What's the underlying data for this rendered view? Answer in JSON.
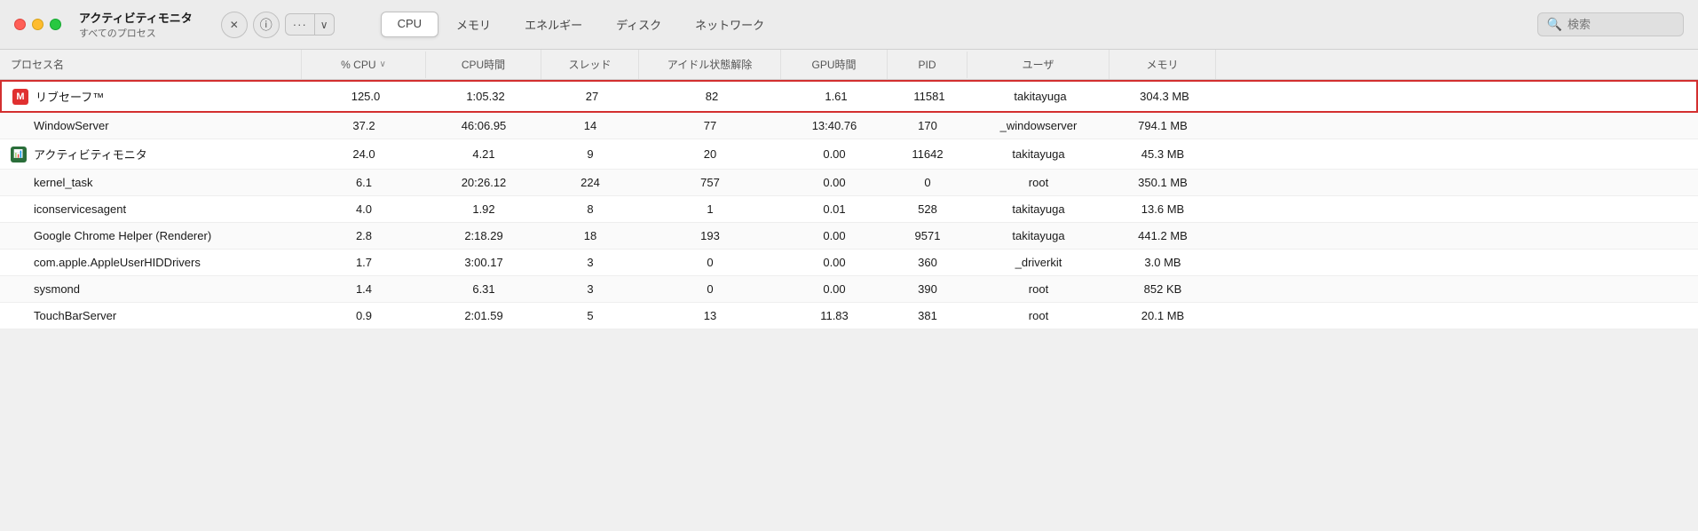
{
  "window": {
    "title": "アクティビティモニタ",
    "subtitle": "すべてのプロセス"
  },
  "traffic_lights": {
    "red_label": "close",
    "yellow_label": "minimize",
    "green_label": "maximize"
  },
  "toolbar": {
    "close_icon": "✕",
    "info_icon": "ⓘ",
    "more_icon": "···",
    "chevron_icon": "∨"
  },
  "tabs": [
    {
      "label": "CPU",
      "active": true
    },
    {
      "label": "メモリ",
      "active": false
    },
    {
      "label": "エネルギー",
      "active": false
    },
    {
      "label": "ディスク",
      "active": false
    },
    {
      "label": "ネットワーク",
      "active": false
    }
  ],
  "search": {
    "placeholder": "検索",
    "value": ""
  },
  "columns": [
    {
      "key": "name",
      "label": "プロセス名"
    },
    {
      "key": "cpu",
      "label": "% CPU",
      "sorted": true,
      "sort_dir": "desc"
    },
    {
      "key": "cputime",
      "label": "CPU時間"
    },
    {
      "key": "threads",
      "label": "スレッド"
    },
    {
      "key": "idle",
      "label": "アイドル状態解除"
    },
    {
      "key": "gpu",
      "label": "GPU時間"
    },
    {
      "key": "pid",
      "label": "PID"
    },
    {
      "key": "user",
      "label": "ユーザ"
    },
    {
      "key": "mem",
      "label": "メモリ"
    }
  ],
  "rows": [
    {
      "name": "リブセーフ™",
      "cpu": "125.0",
      "cputime": "1:05.32",
      "threads": "27",
      "idle": "82",
      "gpu": "1.61",
      "pid": "11581",
      "user": "takitayuga",
      "mem": "304.3 MB",
      "highlighted": true,
      "has_icon": true,
      "icon_type": "libsafe"
    },
    {
      "name": "WindowServer",
      "cpu": "37.2",
      "cputime": "46:06.95",
      "threads": "14",
      "idle": "77",
      "gpu": "13:40.76",
      "pid": "170",
      "user": "_windowserver",
      "mem": "794.1 MB",
      "highlighted": false,
      "has_icon": false
    },
    {
      "name": "アクティビティモニタ",
      "cpu": "24.0",
      "cputime": "4.21",
      "threads": "9",
      "idle": "20",
      "gpu": "0.00",
      "pid": "11642",
      "user": "takitayuga",
      "mem": "45.3 MB",
      "highlighted": false,
      "has_icon": true,
      "icon_type": "activity"
    },
    {
      "name": "kernel_task",
      "cpu": "6.1",
      "cputime": "20:26.12",
      "threads": "224",
      "idle": "757",
      "gpu": "0.00",
      "pid": "0",
      "user": "root",
      "mem": "350.1 MB",
      "highlighted": false,
      "has_icon": false
    },
    {
      "name": "iconservicesagent",
      "cpu": "4.0",
      "cputime": "1.92",
      "threads": "8",
      "idle": "1",
      "gpu": "0.01",
      "pid": "528",
      "user": "takitayuga",
      "mem": "13.6 MB",
      "highlighted": false,
      "has_icon": false
    },
    {
      "name": "Google Chrome Helper (Renderer)",
      "cpu": "2.8",
      "cputime": "2:18.29",
      "threads": "18",
      "idle": "193",
      "gpu": "0.00",
      "pid": "9571",
      "user": "takitayuga",
      "mem": "441.2 MB",
      "highlighted": false,
      "has_icon": false
    },
    {
      "name": "com.apple.AppleUserHIDDrivers",
      "cpu": "1.7",
      "cputime": "3:00.17",
      "threads": "3",
      "idle": "0",
      "gpu": "0.00",
      "pid": "360",
      "user": "_driverkit",
      "mem": "3.0 MB",
      "highlighted": false,
      "has_icon": false
    },
    {
      "name": "sysmond",
      "cpu": "1.4",
      "cputime": "6.31",
      "threads": "3",
      "idle": "0",
      "gpu": "0.00",
      "pid": "390",
      "user": "root",
      "mem": "852 KB",
      "highlighted": false,
      "has_icon": false
    },
    {
      "name": "TouchBarServer",
      "cpu": "0.9",
      "cputime": "2:01.59",
      "threads": "5",
      "idle": "13",
      "gpu": "11.83",
      "pid": "381",
      "user": "root",
      "mem": "20.1 MB",
      "highlighted": false,
      "has_icon": false
    }
  ]
}
